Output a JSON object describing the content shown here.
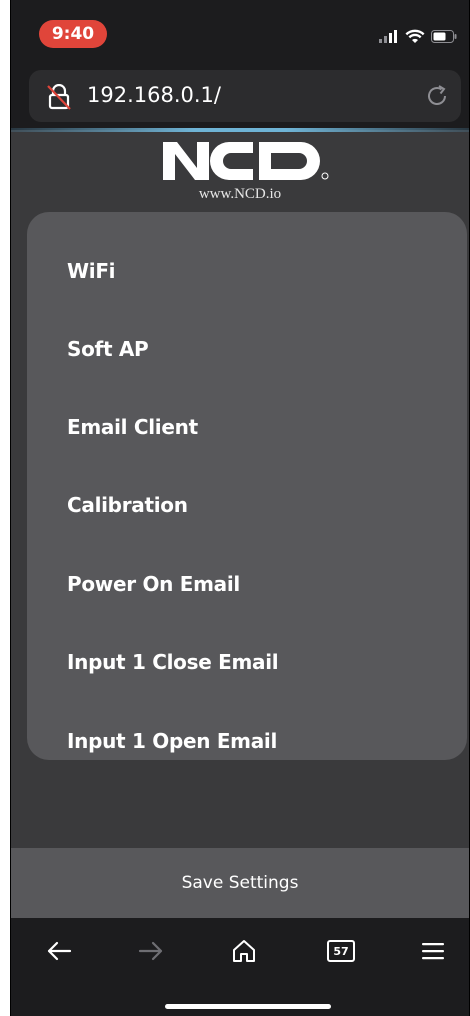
{
  "status_bar": {
    "time": "9:40"
  },
  "browser": {
    "url": "192.168.0.1/"
  },
  "logo": {
    "text": "NCD",
    "url": "www.NCD.io"
  },
  "menu": {
    "items": [
      {
        "label": "WiFi"
      },
      {
        "label": "Soft AP"
      },
      {
        "label": "Email Client"
      },
      {
        "label": "Calibration"
      },
      {
        "label": "Power On Email"
      },
      {
        "label": "Input 1 Close Email"
      },
      {
        "label": "Input 1 Open Email"
      }
    ]
  },
  "actions": {
    "save_label": "Save Settings"
  },
  "toolbar": {
    "tab_count": "57"
  },
  "icons": {
    "lock": "insecure-lock-icon",
    "reload": "reload-icon",
    "back": "back-arrow-icon",
    "forward": "forward-arrow-icon",
    "home": "home-icon",
    "tabs": "tabs-icon",
    "menu": "hamburger-menu-icon"
  },
  "colors": {
    "time_pill": "#e0453a",
    "card": "#58585b",
    "background": "#3a3a3c",
    "accent_line": "#6fb4d6"
  }
}
